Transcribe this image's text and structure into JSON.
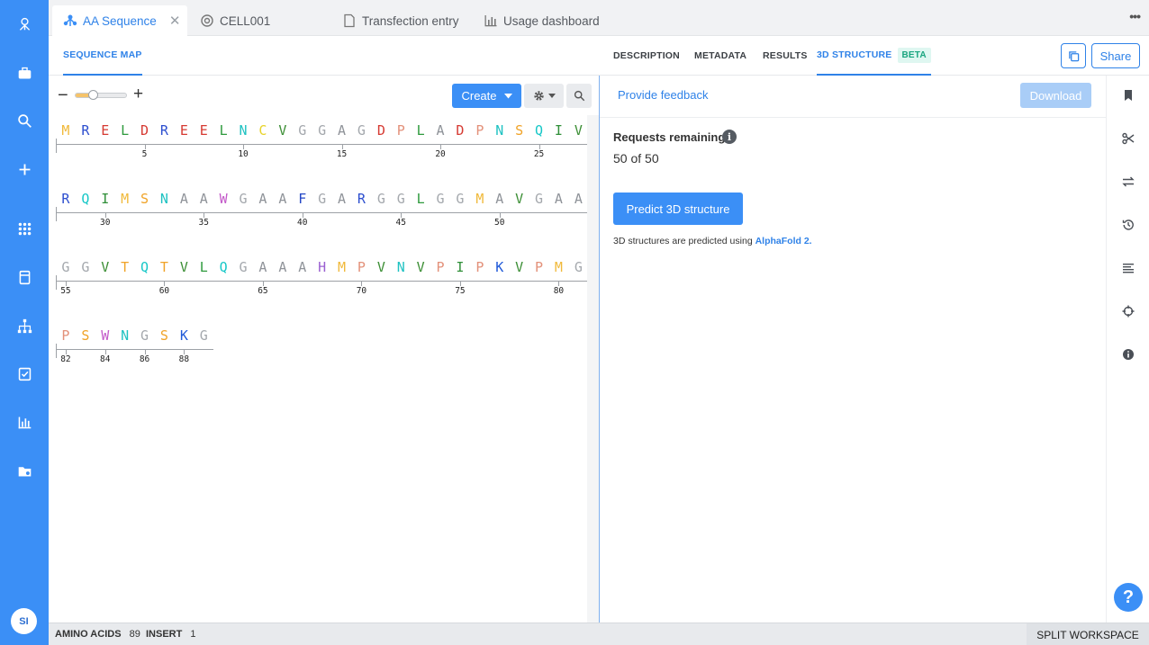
{
  "app": {
    "colors": {
      "brand": "#3b8ff6",
      "accent_text": "#2f82e8",
      "beta_text": "#19a57f"
    },
    "nav": [
      "logo-icon",
      "briefcase-icon",
      "search-icon",
      "plus-icon",
      "grid-icon",
      "notebook-icon",
      "hierarchy-icon",
      "checklist-icon",
      "bar-chart-icon",
      "folder-icon"
    ],
    "user_initials": "SI"
  },
  "tabs": [
    {
      "label": "AA Sequence",
      "icon": "sequence-icon",
      "active": true
    },
    {
      "label": "CELL001",
      "icon": "cell-icon"
    },
    {
      "label": "Transfection entry",
      "icon": "document-icon"
    },
    {
      "label": "Usage dashboard",
      "icon": "bar-chart-icon"
    }
  ],
  "subheader": {
    "left_tab": "SEQUENCE MAP",
    "right_tabs": [
      "DESCRIPTION",
      "METADATA",
      "RESULTS",
      "3D STRUCTURE"
    ],
    "beta": "BETA",
    "share": "Share"
  },
  "toolbar": {
    "create": "Create"
  },
  "sequence": {
    "rows": [
      {
        "residues": "MRELDREELNCVGGAGDPLADPNSQIV",
        "ticks": [
          5,
          10,
          15,
          20,
          25
        ]
      },
      {
        "residues": "RQIMSNAAWGAAFGARGGLGGMAVGAA",
        "ticks": [
          30,
          35,
          40,
          45,
          50
        ]
      },
      {
        "residues": "GGVTQTVLQGAAAHMPVNVPIPKVPMG",
        "ticks": [
          55,
          60,
          65,
          70,
          75,
          80
        ]
      },
      {
        "residues": "PSWNGSKG",
        "ticks": [
          82,
          84,
          86,
          88
        ]
      }
    ]
  },
  "structure_panel": {
    "feedback": "Provide feedback",
    "download": "Download",
    "requests_label": "Requests remaining",
    "requests_value": "50 of 50",
    "predict": "Predict 3D structure",
    "note_prefix": "3D structures are predicted using ",
    "note_link": "AlphaFold 2",
    "note_suffix": "."
  },
  "tools": [
    "bookmark-icon",
    "scissors-icon",
    "swap-icon",
    "history-icon",
    "text-align-icon",
    "target-icon",
    "info-icon"
  ],
  "help": "?",
  "status": {
    "amino_acids_label": "AMINO ACIDS",
    "amino_acids_value": "89",
    "insert_label": "INSERT",
    "insert_value": "1",
    "split": "SPLIT WORKSPACE"
  }
}
